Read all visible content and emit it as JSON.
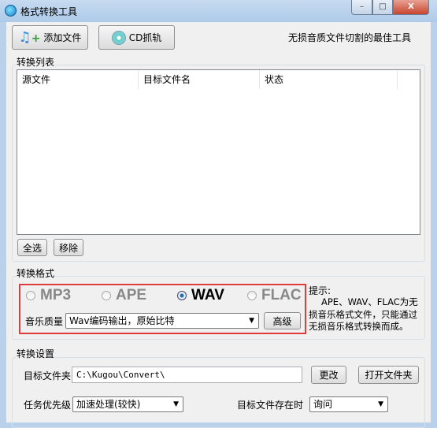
{
  "window": {
    "title": "格式转换工具",
    "minimize": "–",
    "maximize": "□",
    "close": "X"
  },
  "toolbar": {
    "add_file": "添加文件",
    "cd_rip": "CD抓轨",
    "tagline": "无损音质文件切割的最佳工具"
  },
  "list": {
    "group_label": "转换列表",
    "columns": [
      "源文件",
      "目标文件名",
      "状态"
    ],
    "select_all": "全选",
    "remove": "移除"
  },
  "format": {
    "group_label": "转换格式",
    "options": [
      "MP3",
      "APE",
      "WAV",
      "FLAC"
    ],
    "selected": "WAV",
    "quality_label": "音乐质量",
    "quality_value": "Wav编码输出，原始比特",
    "advanced": "高级",
    "hint_title": "提示:",
    "hint_text": "APE、WAV、FLAC为无损音乐格式文件，只能通过无损音乐格式转换而成。"
  },
  "settings": {
    "group_label": "转换设置",
    "folder_label": "目标文件夹",
    "folder_value": "C:\\Kugou\\Convert\\",
    "change": "更改",
    "open_folder": "打开文件夹",
    "priority_label": "任务优先级",
    "priority_value": "加速处理(较快)",
    "exists_label": "目标文件存在时",
    "exists_value": "询问"
  },
  "colors": {
    "highlight": "#e03c3c"
  }
}
